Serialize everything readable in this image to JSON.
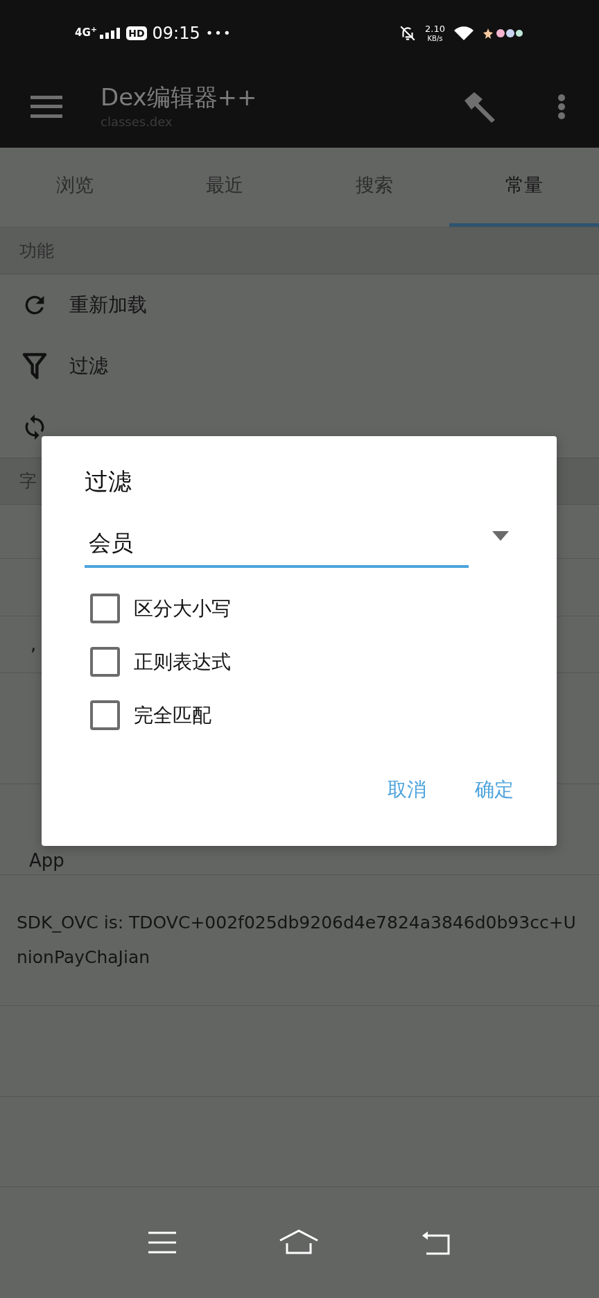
{
  "status_bar": {
    "network": "4G$^{+}$",
    "hd": "HD",
    "time": "09:15",
    "more": "•••",
    "speed": "2.10",
    "speed_unit": "KB/s"
  },
  "app_bar": {
    "title": "Dex编辑器++",
    "subtitle": "classes.dex"
  },
  "tabs": [
    {
      "label": "浏览",
      "selected": false
    },
    {
      "label": "最近",
      "selected": false
    },
    {
      "label": "搜索",
      "selected": false
    },
    {
      "label": "常量",
      "selected": true
    }
  ],
  "sections": [
    {
      "header": "功能",
      "items": [
        {
          "kind": "reload",
          "label": "重新加载"
        },
        {
          "kind": "filter",
          "label": "过滤"
        },
        {
          "kind": "swap"
        }
      ]
    },
    {
      "header": "字",
      "rows": [
        {
          "text": ","
        },
        {
          "text": "App"
        },
        {
          "text": "SDK_OVC is: TDOVC+002f025db9206d4e7824a3846d0b93cc+UnionPayChaJian"
        }
      ]
    }
  ],
  "dialog": {
    "title": "过滤",
    "value": "会员",
    "options": [
      {
        "label": "区分大小写",
        "checked": false
      },
      {
        "label": "正则表达式",
        "checked": false
      },
      {
        "label": "完全匹配",
        "checked": false
      }
    ],
    "buttons": [
      "取消",
      "确定"
    ]
  }
}
